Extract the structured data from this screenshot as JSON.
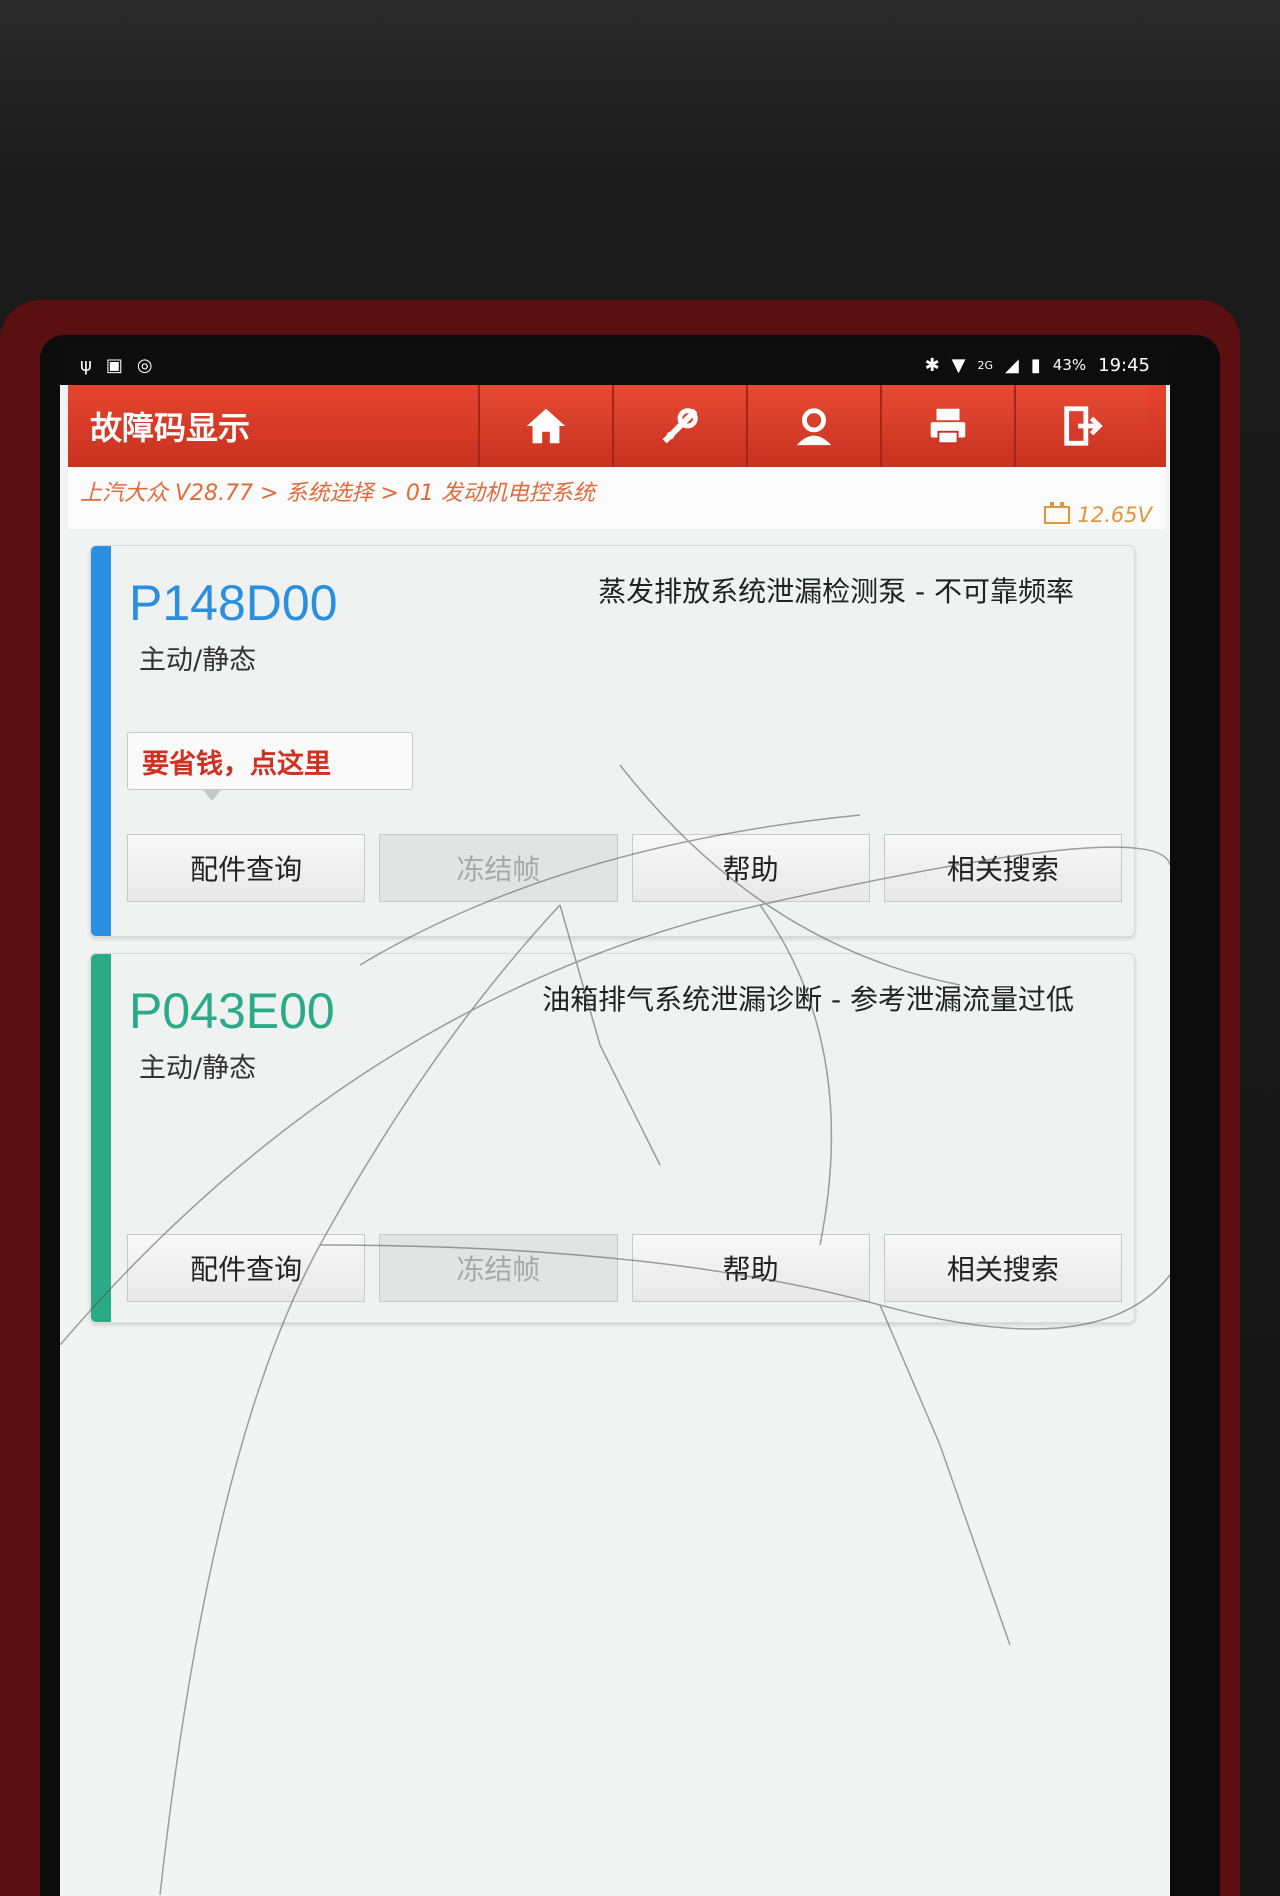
{
  "statusbar": {
    "battery_pct": "43%",
    "time": "19:45",
    "network": "2G"
  },
  "header": {
    "title": "故障码显示"
  },
  "breadcrumb": "上汽大众 V28.77 > 系统选择 > 01 发动机电控系统",
  "voltage": "12.65V",
  "colors": {
    "header_red": "#d63a26",
    "code_blue": "#2a8fe0",
    "code_green": "#2aaa86",
    "promo_red": "#d03020"
  },
  "dtcs": [
    {
      "code": "P148D00",
      "status": "主动/静态",
      "description": "蒸发排放系统泄漏检测泵 - 不可靠频率",
      "promo": "要省钱，点这里",
      "buttons": [
        "配件查询",
        "冻结帧",
        "帮助",
        "相关搜索"
      ]
    },
    {
      "code": "P043E00",
      "status": "主动/静态",
      "description": "油箱排气系统泄漏诊断 - 参考泄漏流量过低",
      "buttons": [
        "配件查询",
        "冻结帧",
        "帮助",
        "相关搜索"
      ]
    }
  ],
  "icons": [
    "home-icon",
    "diagnose-icon",
    "user-icon",
    "print-icon",
    "exit-icon"
  ]
}
